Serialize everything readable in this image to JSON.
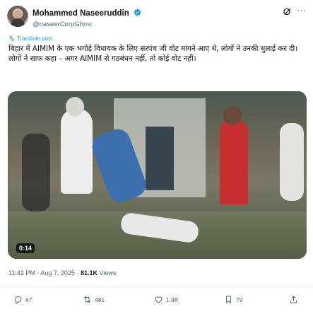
{
  "author": {
    "display_name": "Mohammed Naseeruddin",
    "handle": "@naseerCorpGhmc",
    "verified": true
  },
  "icons": {
    "verified": "verified-badge-icon",
    "grok": "grok-icon",
    "more": "more-options-icon",
    "translate": "translate-icon",
    "reply": "reply-icon",
    "repost": "repost-icon",
    "like": "like-icon",
    "views": "views-icon",
    "share": "share-icon"
  },
  "post": {
    "translate_label": "Translate post",
    "text": "बिहार में AIMIM के एक भगोड़े विधायक के लिए सरपंच जी वोट मांगने आए थे, लोगों ने उनकी धुलाई कर दी। लोगों ने साफ कहा – अगर AIMIM से गठबंधन नहीं, तो कोई वोट नहीं।",
    "video_duration": "0:14"
  },
  "meta": {
    "time": "11:42 PM",
    "date": "Aug 7, 2025",
    "views_count": "81.1K",
    "views_label": "Views"
  },
  "actions": {
    "replies": "67",
    "reposts": "481",
    "likes": "1.9K",
    "views": "79"
  },
  "colors": {
    "accent": "#1d9bf0",
    "text_primary": "#0f1419",
    "text_secondary": "#536471",
    "divider": "#eff3f4"
  }
}
